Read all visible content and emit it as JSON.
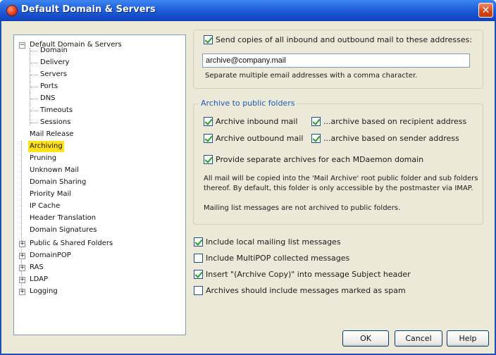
{
  "window": {
    "title": "Default Domain & Servers",
    "close_glyph": "✕"
  },
  "tree": {
    "items": [
      {
        "label": "Default Domain & Servers",
        "expander": "−"
      },
      {
        "label": "Domain"
      },
      {
        "label": "Delivery"
      },
      {
        "label": "Servers"
      },
      {
        "label": "Ports"
      },
      {
        "label": "DNS"
      },
      {
        "label": "Timeouts"
      },
      {
        "label": "Sessions"
      },
      {
        "label": "Mail Release"
      },
      {
        "label": "Archiving",
        "selected": true
      },
      {
        "label": "Pruning"
      },
      {
        "label": "Unknown Mail"
      },
      {
        "label": "Domain Sharing"
      },
      {
        "label": "Priority Mail"
      },
      {
        "label": "IP Cache"
      },
      {
        "label": "Header Translation"
      },
      {
        "label": "Domain Signatures"
      },
      {
        "label": "Public & Shared Folders",
        "expander": "+"
      },
      {
        "label": "DomainPOP",
        "expander": "+"
      },
      {
        "label": "RAS",
        "expander": "+"
      },
      {
        "label": "LDAP",
        "expander": "+"
      },
      {
        "label": "Logging",
        "expander": "+"
      }
    ]
  },
  "send_copies": {
    "label": "Send copies of all inbound and outbound mail to these addresses:",
    "checked": true,
    "address_value": "archive@company.mail",
    "hint": "Separate multiple email addresses with a comma character."
  },
  "public_folders": {
    "legend": "Archive to public folders",
    "archive_inbound": {
      "label": "Archive inbound mail",
      "checked": true
    },
    "archive_outbound": {
      "label": "Archive outbound mail",
      "checked": true
    },
    "by_recipient": {
      "label": "...archive based on recipient address",
      "checked": true
    },
    "by_sender": {
      "label": "...archive based on sender address",
      "checked": true
    },
    "separate_archives": {
      "label": "Provide separate archives for each MDaemon domain",
      "checked": true
    },
    "info_line1": "All mail will be copied into the 'Mail Archive' root public folder and sub folders",
    "info_line2": "thereof.  By default, this folder is only accessible by the postmaster via IMAP.",
    "info_line3": "Mailing list messages are not archived to public folders."
  },
  "options": {
    "include_local_lists": {
      "label": "Include local mailing list messages",
      "checked": true
    },
    "include_multipop": {
      "label": "Include MultiPOP collected messages",
      "checked": false
    },
    "insert_archive_copy": {
      "label": "Insert \"(Archive Copy)\" into message Subject header",
      "checked": true
    },
    "include_spam": {
      "label": "Archives should include messages marked as spam",
      "checked": false
    }
  },
  "buttons": {
    "ok": "OK",
    "cancel": "Cancel",
    "help": "Help"
  }
}
